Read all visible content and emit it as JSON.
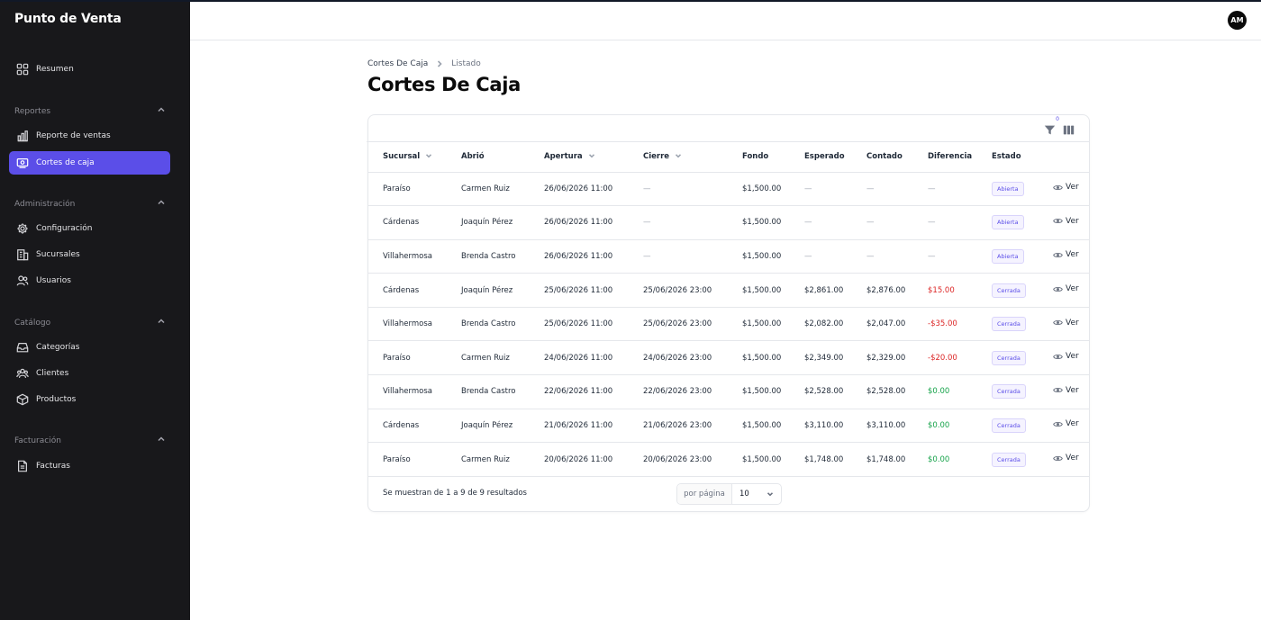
{
  "app": {
    "name": "Punto de Venta",
    "user_initials": "AM"
  },
  "sidebar": {
    "resumen": "Resumen",
    "sections": {
      "reportes": "Reportes",
      "administracion": "Administración",
      "catalogo": "Catálogo",
      "facturacion": "Facturación"
    },
    "items": {
      "reporte_ventas": "Reporte de ventas",
      "cortes_caja": "Cortes de caja",
      "configuracion": "Configuración",
      "sucursales": "Sucursales",
      "usuarios": "Usuarios",
      "categorias": "Categorías",
      "clientes": "Clientes",
      "productos": "Productos",
      "facturas": "Facturas"
    },
    "active_color": "#5b4ee8"
  },
  "breadcrumb": {
    "parent": "Cortes De Caja",
    "current": "Listado"
  },
  "page_title": "Cortes De Caja",
  "toolbar": {
    "filter_count": "0"
  },
  "table": {
    "headers": {
      "sucursal": "Sucursal",
      "abrio": "Abrió",
      "apertura": "Apertura",
      "cierre": "Cierre",
      "fondo": "Fondo",
      "esperado": "Esperado",
      "contado": "Contado",
      "diferencia": "Diferencia",
      "estado": "Estado"
    },
    "action_label": "Ver",
    "rows": [
      {
        "sucursal": "Paraíso",
        "abrio": "Carmen Ruiz",
        "apertura": "26/06/2026 11:00",
        "cierre": "—",
        "fondo": "$1,500.00",
        "esperado": "—",
        "contado": "—",
        "diferencia": "—",
        "estado": "Abierta"
      },
      {
        "sucursal": "Cárdenas",
        "abrio": "Joaquín Pérez",
        "apertura": "26/06/2026 11:00",
        "cierre": "—",
        "fondo": "$1,500.00",
        "esperado": "—",
        "contado": "—",
        "diferencia": "—",
        "estado": "Abierta"
      },
      {
        "sucursal": "Villahermosa",
        "abrio": "Brenda Castro",
        "apertura": "26/06/2026 11:00",
        "cierre": "—",
        "fondo": "$1,500.00",
        "esperado": "—",
        "contado": "—",
        "diferencia": "—",
        "estado": "Abierta"
      },
      {
        "sucursal": "Cárdenas",
        "abrio": "Joaquín Pérez",
        "apertura": "25/06/2026 11:00",
        "cierre": "25/06/2026 23:00",
        "fondo": "$1,500.00",
        "esperado": "$2,861.00",
        "contado": "$2,876.00",
        "diferencia": "$15.00",
        "estado": "Cerrada"
      },
      {
        "sucursal": "Villahermosa",
        "abrio": "Brenda Castro",
        "apertura": "25/06/2026 11:00",
        "cierre": "25/06/2026 23:00",
        "fondo": "$1,500.00",
        "esperado": "$2,082.00",
        "contado": "$2,047.00",
        "diferencia": "-$35.00",
        "estado": "Cerrada"
      },
      {
        "sucursal": "Paraíso",
        "abrio": "Carmen Ruiz",
        "apertura": "24/06/2026 11:00",
        "cierre": "24/06/2026 23:00",
        "fondo": "$1,500.00",
        "esperado": "$2,349.00",
        "contado": "$2,329.00",
        "diferencia": "-$20.00",
        "estado": "Cerrada"
      },
      {
        "sucursal": "Villahermosa",
        "abrio": "Brenda Castro",
        "apertura": "22/06/2026 11:00",
        "cierre": "22/06/2026 23:00",
        "fondo": "$1,500.00",
        "esperado": "$2,528.00",
        "contado": "$2,528.00",
        "diferencia": "$0.00",
        "estado": "Cerrada"
      },
      {
        "sucursal": "Cárdenas",
        "abrio": "Joaquín Pérez",
        "apertura": "21/06/2026 11:00",
        "cierre": "21/06/2026 23:00",
        "fondo": "$1,500.00",
        "esperado": "$3,110.00",
        "contado": "$3,110.00",
        "diferencia": "$0.00",
        "estado": "Cerrada"
      },
      {
        "sucursal": "Paraíso",
        "abrio": "Carmen Ruiz",
        "apertura": "20/06/2026 11:00",
        "cierre": "20/06/2026 23:00",
        "fondo": "$1,500.00",
        "esperado": "$1,748.00",
        "contado": "$1,748.00",
        "diferencia": "$0.00",
        "estado": "Cerrada"
      }
    ]
  },
  "footer": {
    "results_text": "Se muestran de 1 a 9 de 9 resultados",
    "per_page_label": "por página",
    "per_page_value": "10"
  }
}
